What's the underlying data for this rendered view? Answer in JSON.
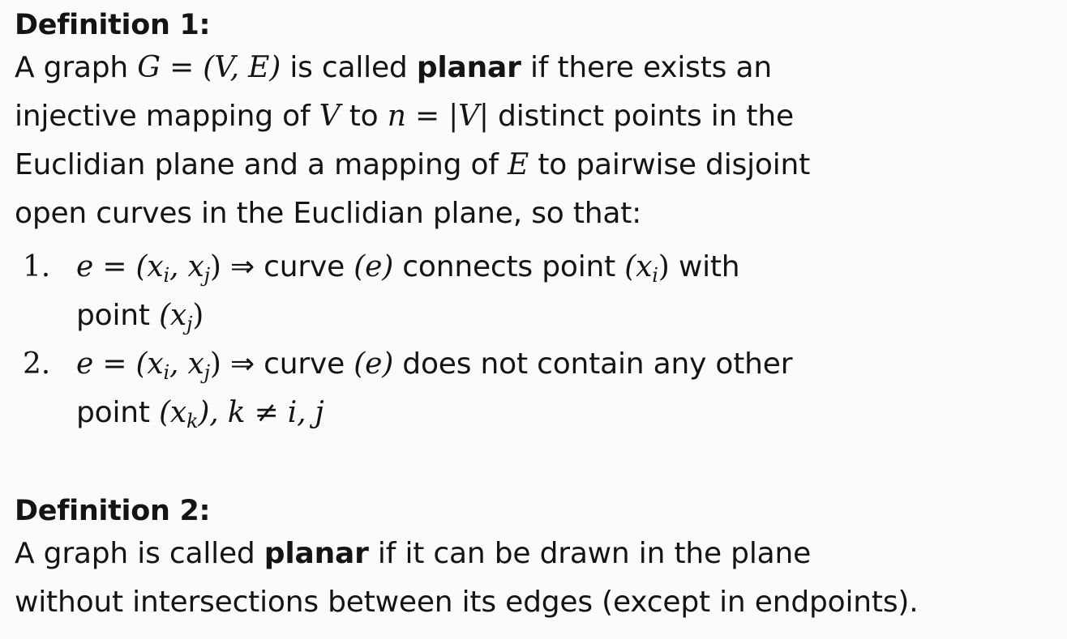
{
  "definition1": {
    "heading": "Definition 1:",
    "intro_1": "A graph ",
    "math_graph": "G = (V, E)",
    "intro_2": " is called ",
    "keyword": "planar",
    "intro_3": " if there exists an",
    "line2_a": "injective mapping of ",
    "math_V": "V",
    "line2_b": " to ",
    "math_n": "n = |V|",
    "line2_c": " distinct points in the",
    "line3_a": "Euclidian plane and a mapping of ",
    "math_E": "E",
    "line3_b": " to pairwise disjoint",
    "line4": "open curves in the Euclidian plane, so that:",
    "conditions": [
      {
        "number": "1.",
        "math_edge": "e = (x",
        "sub_i": "i",
        "math_mid": ", x",
        "sub_j": "j",
        "math_close": ")",
        "implies": " ⇒ ",
        "text_a": "curve ",
        "math_e": "(e)",
        "text_b": " connects point ",
        "math_xi": "(x",
        "sub_xi": "i",
        "math_xi_close": ")",
        "text_c": " with",
        "line2_text": "point ",
        "math_xj": "(x",
        "sub_xj": "j",
        "math_xj_close": ")"
      },
      {
        "number": "2.",
        "math_edge": "e = (x",
        "sub_i": "i",
        "math_mid": ", x",
        "sub_j": "j",
        "math_close": ")",
        "implies": " ⇒ ",
        "text_a": "curve ",
        "math_e": "(e)",
        "text_b": " does not contain any other",
        "line2_text": "point ",
        "math_xk": "(x",
        "sub_xk": "k",
        "math_xk_close": "), k ≠ i, j"
      }
    ]
  },
  "definition2": {
    "heading": "Definition 2:",
    "line1_a": "A graph is called ",
    "keyword": "planar",
    "line1_b": " if it can be drawn in the plane",
    "line2": "without intersections between its edges (except in endpoints)."
  }
}
